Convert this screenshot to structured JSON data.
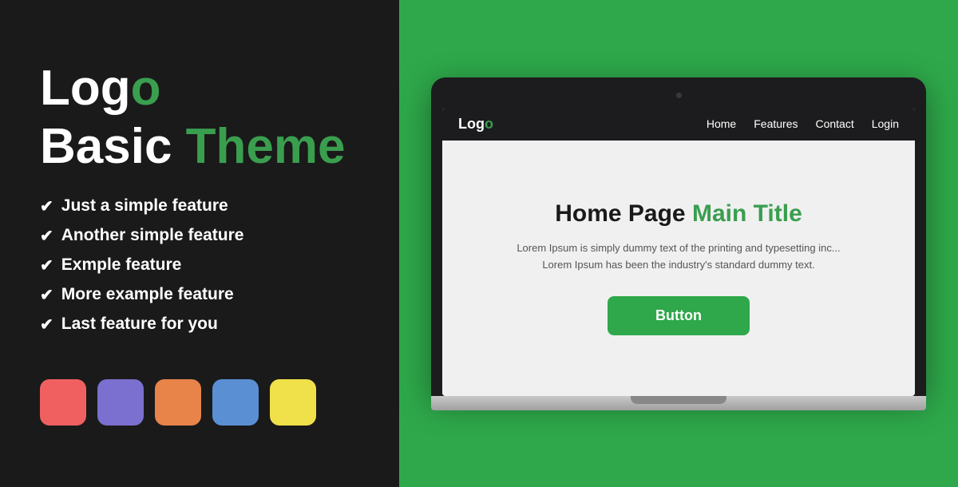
{
  "left": {
    "logo_text": "Logo",
    "logo_green": "o",
    "title_black": "Basic ",
    "title_green": "Theme",
    "features": [
      "Just a simple feature",
      "Another simple feature",
      "Exmple feature",
      "More example feature",
      "Last feature for you"
    ],
    "swatches": [
      {
        "color": "#f06060",
        "label": "red-swatch"
      },
      {
        "color": "#7b6fcf",
        "label": "purple-swatch"
      },
      {
        "color": "#e8834a",
        "label": "orange-swatch"
      },
      {
        "color": "#5b8fd4",
        "label": "blue-swatch"
      },
      {
        "color": "#f0e04a",
        "label": "yellow-swatch"
      }
    ]
  },
  "right": {
    "browser": {
      "logo_black": "Log",
      "logo_green": "o",
      "nav_items": [
        "Home",
        "Features",
        "Contact",
        "Login"
      ]
    },
    "website": {
      "hero_black": "Home Page ",
      "hero_green": "Main Title",
      "description": "Lorem Ipsum is simply dummy text of the printing and typesetting inc... Lorem Ipsum has been the industry's standard dummy text.",
      "button_label": "Button"
    }
  }
}
